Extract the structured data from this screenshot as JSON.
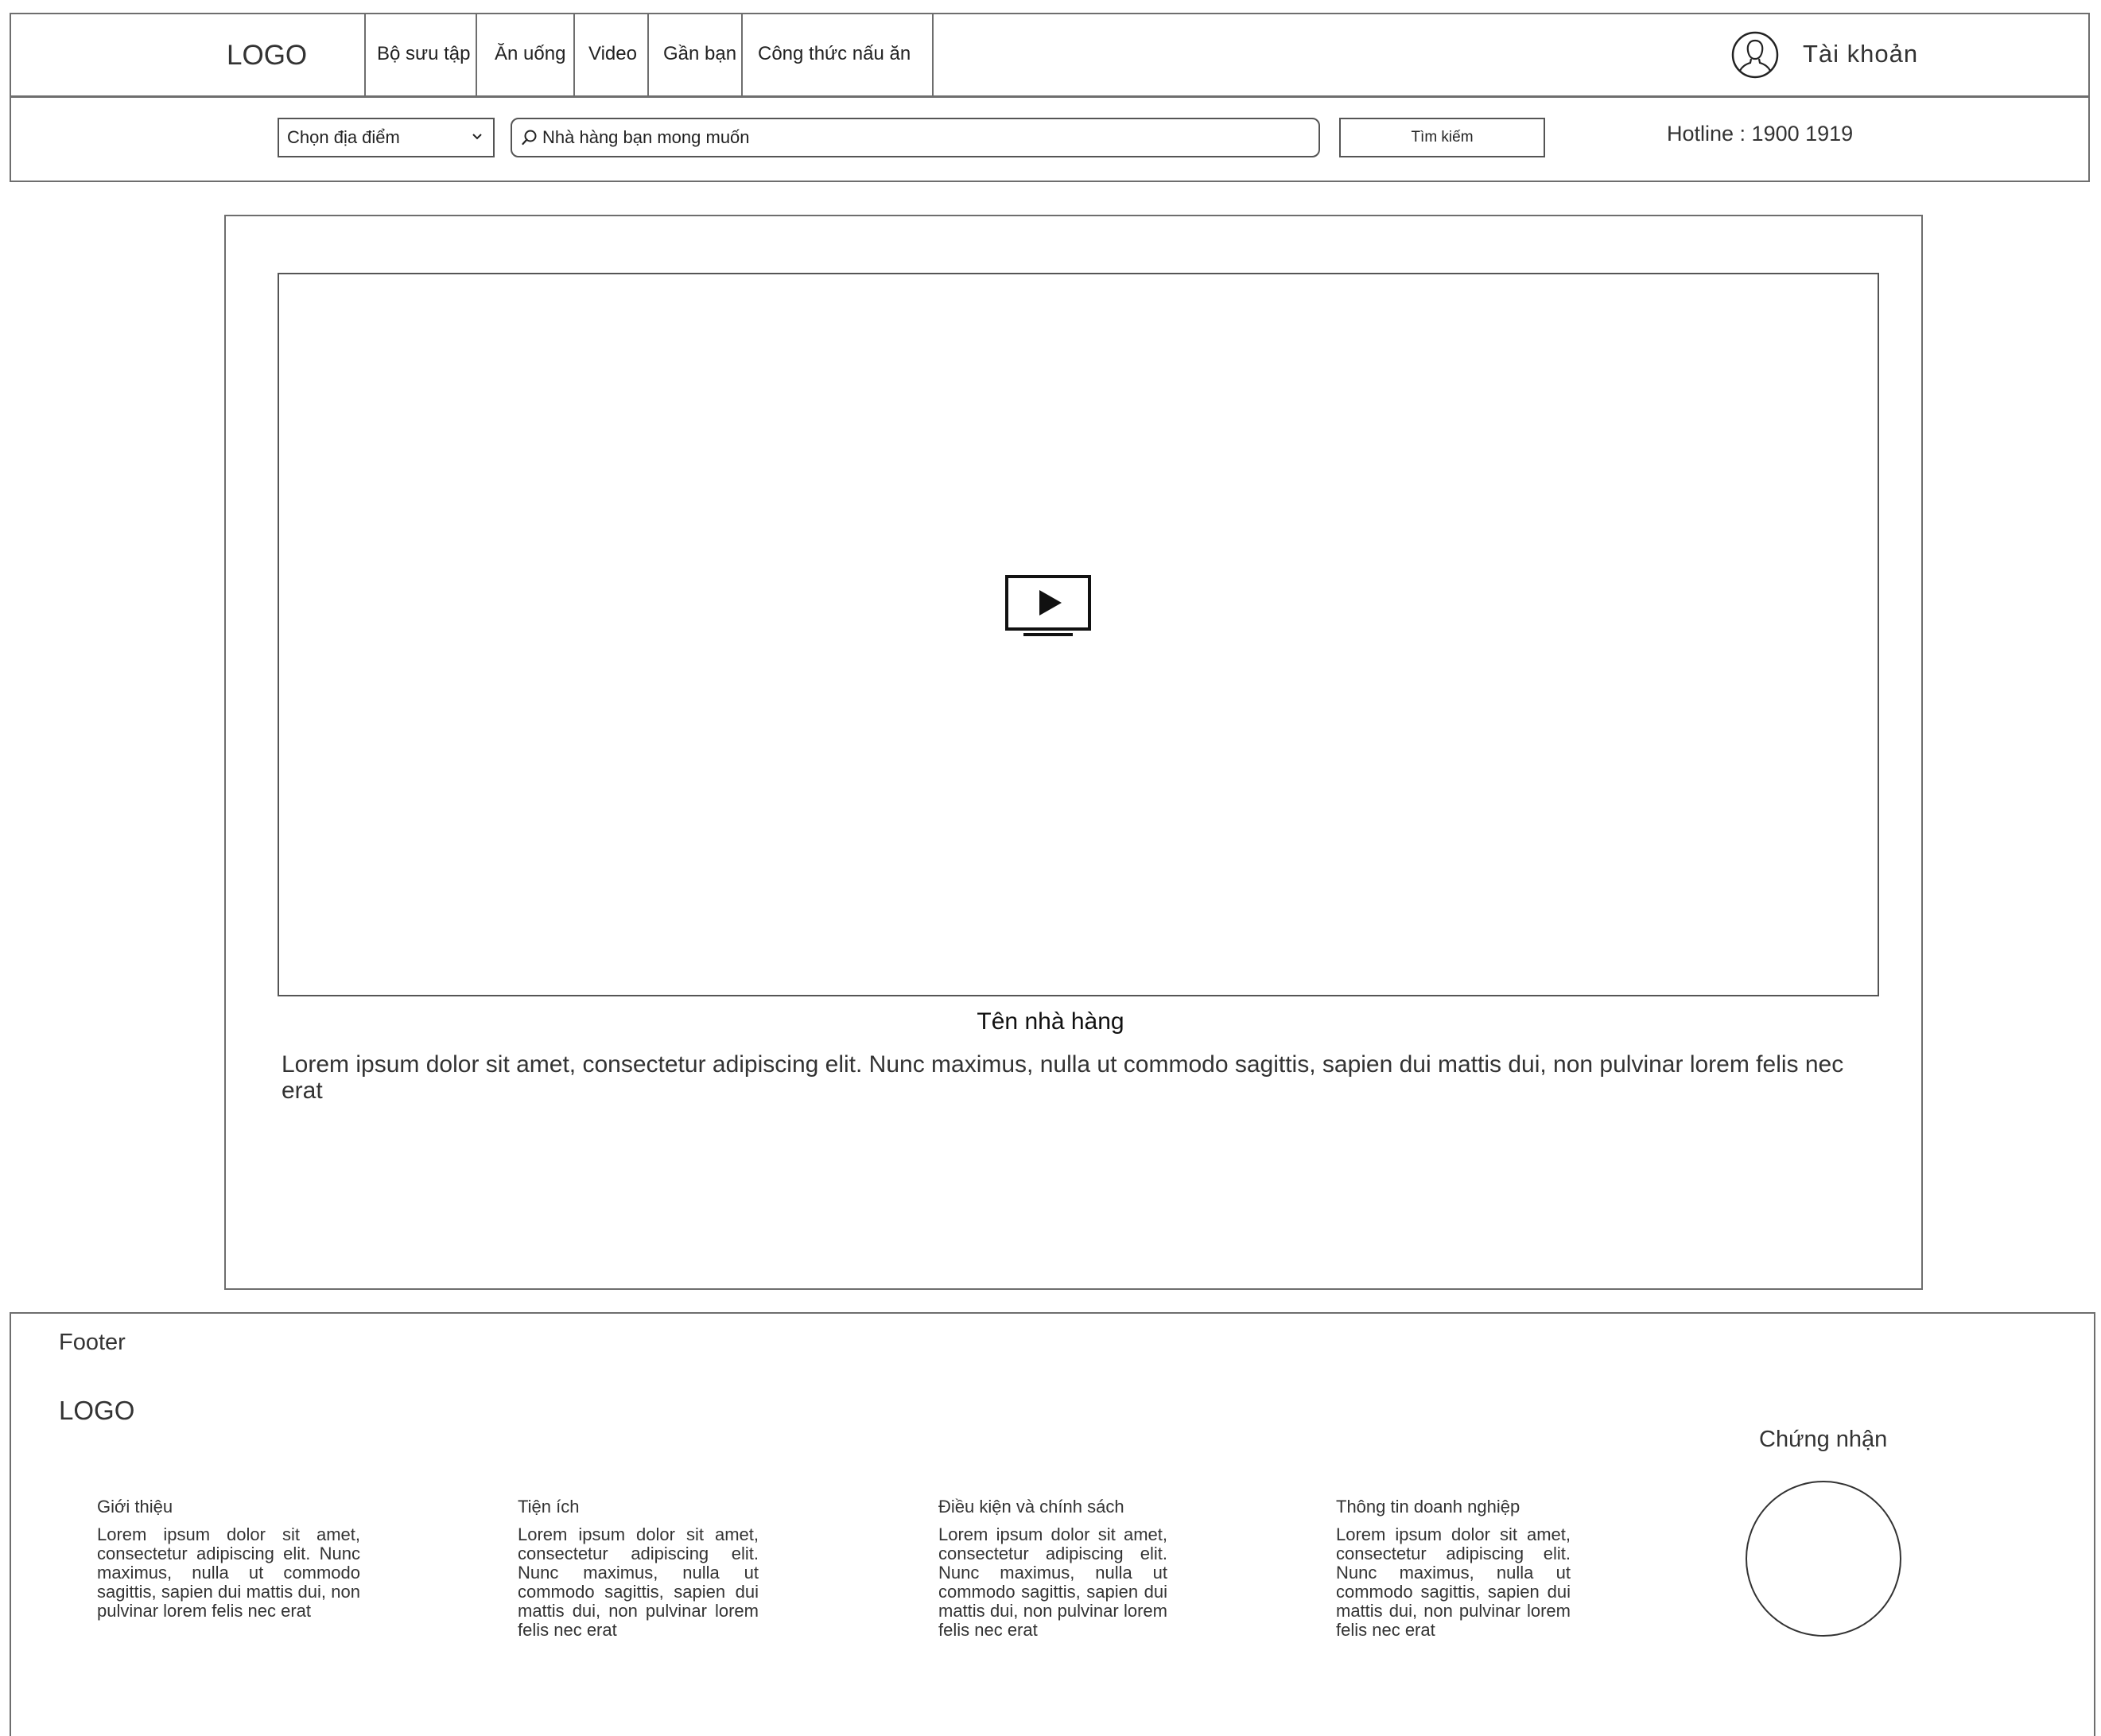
{
  "header": {
    "logo": "LOGO",
    "nav": [
      "Bộ sưu tập",
      "Ăn uống",
      "Video",
      "Gần bạn",
      "Công thức nấu ăn"
    ],
    "account_label": "Tài  khoản",
    "account_icon": "user-avatar-icon"
  },
  "search": {
    "location_value": "Chọn địa điểm",
    "placeholder": "Nhà hàng bạn mong muốn",
    "button_label": "Tìm kiếm",
    "hotline": "Hotline : 1900 1919"
  },
  "main": {
    "video_icon": "tv-play-icon",
    "restaurant_name": "Tên nhà hàng",
    "description": "Lorem ipsum dolor sit amet, consectetur adipiscing elit. Nunc maximus, nulla ut commodo sagittis, sapien dui mattis dui, non pulvinar lorem felis nec erat"
  },
  "footer": {
    "title": "Footer",
    "logo": "LOGO",
    "columns": [
      {
        "heading": "Giới thiệu",
        "text": "Lorem ipsum dolor sit amet, consectetur adipiscing elit. Nunc maximus, nulla ut commodo sagittis, sapien dui mattis dui, non pulvinar lorem felis nec erat"
      },
      {
        "heading": "Tiện ích",
        "text": "Lorem ipsum dolor sit amet, consectetur adipiscing elit. Nunc maximus, nulla ut commodo sagittis, sapien dui mattis dui, non pulvinar lorem felis nec erat"
      },
      {
        "heading": "Điều kiện và chính sách",
        "text": "Lorem ipsum dolor sit amet, consectetur adipiscing elit. Nunc maximus, nulla ut commodo sagittis, sapien dui mattis dui, non pulvinar lorem felis nec erat"
      },
      {
        "heading": "Thông tin doanh nghiệp",
        "text": "Lorem ipsum dolor sit amet, consectetur adipiscing elit. Nunc maximus, nulla ut commodo sagittis, sapien dui mattis dui, non pulvinar lorem felis nec erat"
      }
    ],
    "certification_title": "Chứng nhận"
  }
}
